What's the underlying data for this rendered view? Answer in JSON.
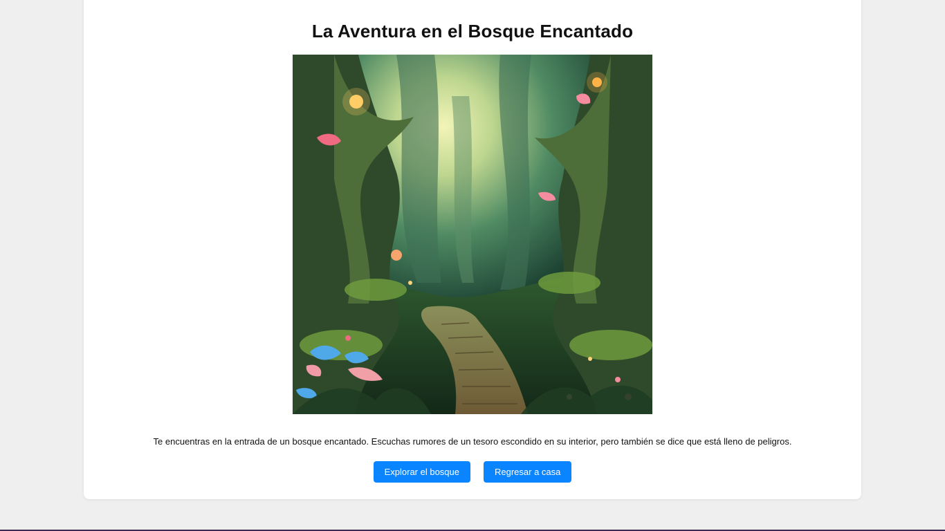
{
  "story": {
    "title": "La Aventura en el Bosque Encantado",
    "scene_image": "enchanted-forest-path",
    "text": "Te encuentras en la entrada de un bosque encantado. Escuchas rumores de un tesoro escondido en su interior, pero también se dice que está lleno de peligros."
  },
  "choices": [
    {
      "label": "Explorar el bosque"
    },
    {
      "label": "Regresar a casa"
    }
  ],
  "colors": {
    "page_background": "#efefef",
    "card_background": "#ffffff",
    "button": "#0a84ff",
    "button_text": "#ffffff"
  }
}
